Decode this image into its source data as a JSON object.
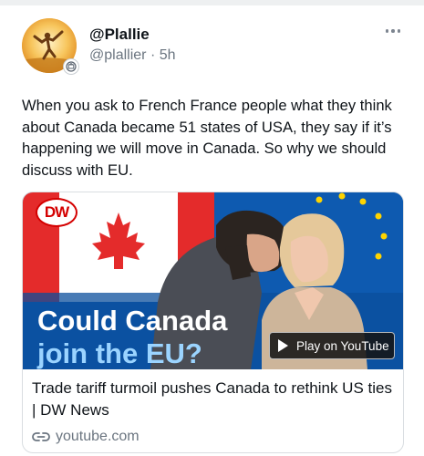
{
  "post": {
    "display_name": "@Plallie",
    "handle": "@plallier",
    "separator": "·",
    "time": "5h",
    "more_icon": "more-options-icon",
    "text": "When you ask to French France people what they think about Canada became 51 states of USA, they say if it’s happening we will move in Canada. So why we should discuss with EU."
  },
  "card": {
    "source_logo": "DW",
    "overlay_title": "Could Canada",
    "overlay_subtitle": "join the EU?",
    "play_button_label": "Play on YouTube",
    "title": "Trade tariff turmoil pushes Canada to rethink US ties | DW News",
    "domain": "youtube.com",
    "link_icon": "link-icon"
  },
  "colors": {
    "text_primary": "#0f1419",
    "text_secondary": "#6b7580",
    "dw_red": "#d40000",
    "canada_red": "#e42b2b",
    "eu_blue": "#0e5ab0",
    "eu_star": "#ffd400",
    "subtitle_blue": "#9bd4ff"
  }
}
